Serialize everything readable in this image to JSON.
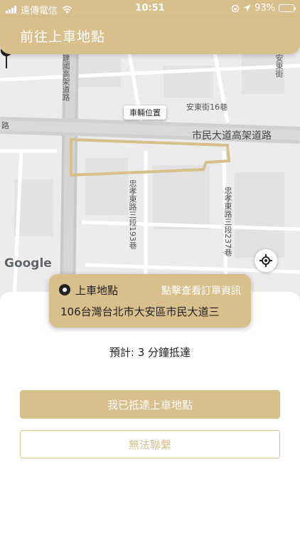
{
  "status_bar": {
    "carrier": "遠傳電信",
    "time": "10:51",
    "battery": "93%",
    "battery_level": 0.93,
    "icons": [
      "signal-icon",
      "wifi-icon",
      "rotation-lock-icon",
      "location-arrow-icon",
      "battery-icon"
    ]
  },
  "header": {
    "title": "前往上車地點"
  },
  "map": {
    "labels": {
      "road_1": "建國高架道路",
      "road_2": "安東街16巷",
      "road_3": "市民大道高架道路",
      "road_4": "忠孝東路三段193巷",
      "road_5": "忠孝東路三段237巷",
      "road_6": "安東街",
      "road_7": "路"
    },
    "vehicle_tag": "車輛位置",
    "logo": "Google"
  },
  "pickup": {
    "label": "上車地點",
    "order_link": "點擊查看訂單資訊",
    "address": "106台灣台北市大安區市民大道三"
  },
  "eta": "預計: 3 分鐘抵達",
  "buttons": {
    "arrived": "我已抵達上車地點",
    "cannot_contact": "無法聯繫"
  },
  "colors": {
    "accent": "#d8bf8c",
    "pickup_outline": "#d8bf8c"
  }
}
